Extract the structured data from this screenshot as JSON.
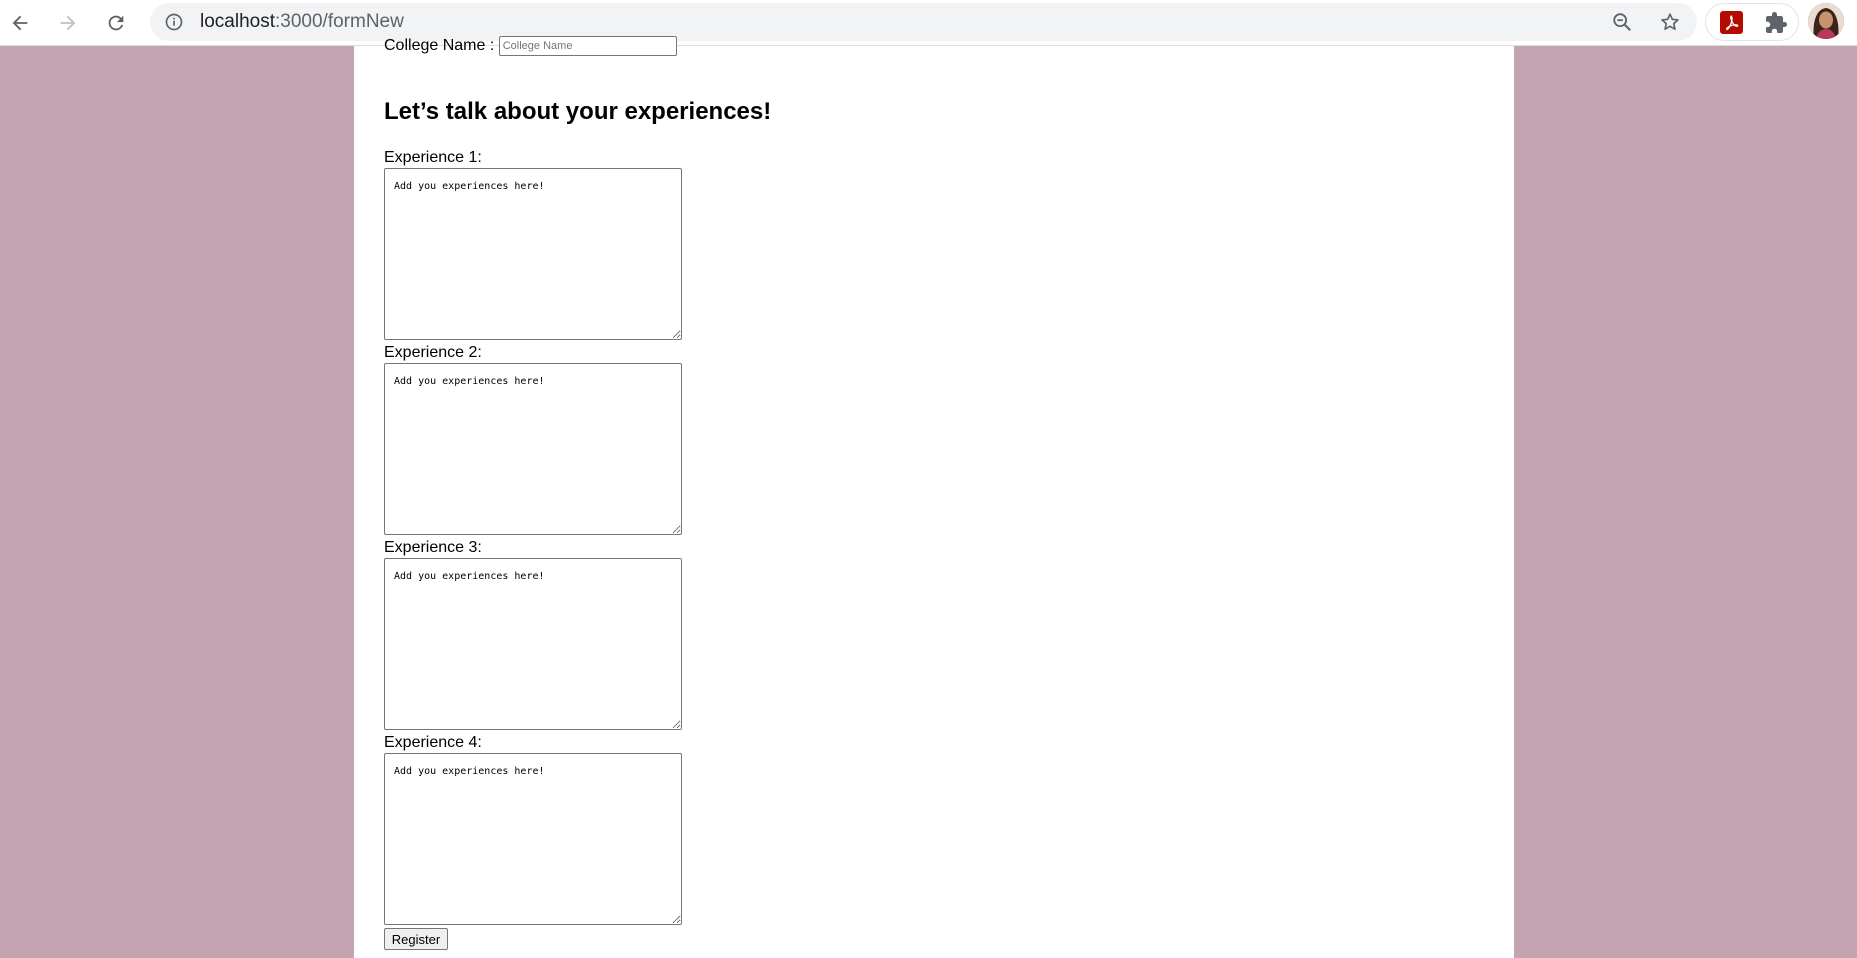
{
  "browser": {
    "url_host": "localhost",
    "url_path": ":3000/formNew",
    "icons": {
      "back": "arrow-left-icon",
      "forward": "arrow-right-icon",
      "reload": "reload-icon",
      "site_info": "info-icon",
      "zoom": "zoom-out-icon",
      "bookmark": "star-icon",
      "pdf_extension": "acrobat-pdf-icon",
      "extensions": "puzzle-icon",
      "profile": "avatar"
    }
  },
  "form": {
    "college": {
      "label": "College Name :",
      "placeholder": "College Name"
    },
    "experiences_heading": "Let’s talk about your experiences!",
    "experiences": [
      {
        "label": "Experience 1:",
        "placeholder": "Add you experiences here!"
      },
      {
        "label": "Experience 2:",
        "placeholder": "Add you experiences here!"
      },
      {
        "label": "Experience 3:",
        "placeholder": "Add you experiences here!"
      },
      {
        "label": "Experience 4:",
        "placeholder": "Add you experiences here!"
      }
    ],
    "submit_label": "Register"
  },
  "colors": {
    "page_background": "#c4a4b0",
    "content_background": "#ffffff",
    "toolbar_background": "#ffffff",
    "omnibox_background": "#f1f3f4",
    "pdf_icon_red": "#b30b00"
  }
}
